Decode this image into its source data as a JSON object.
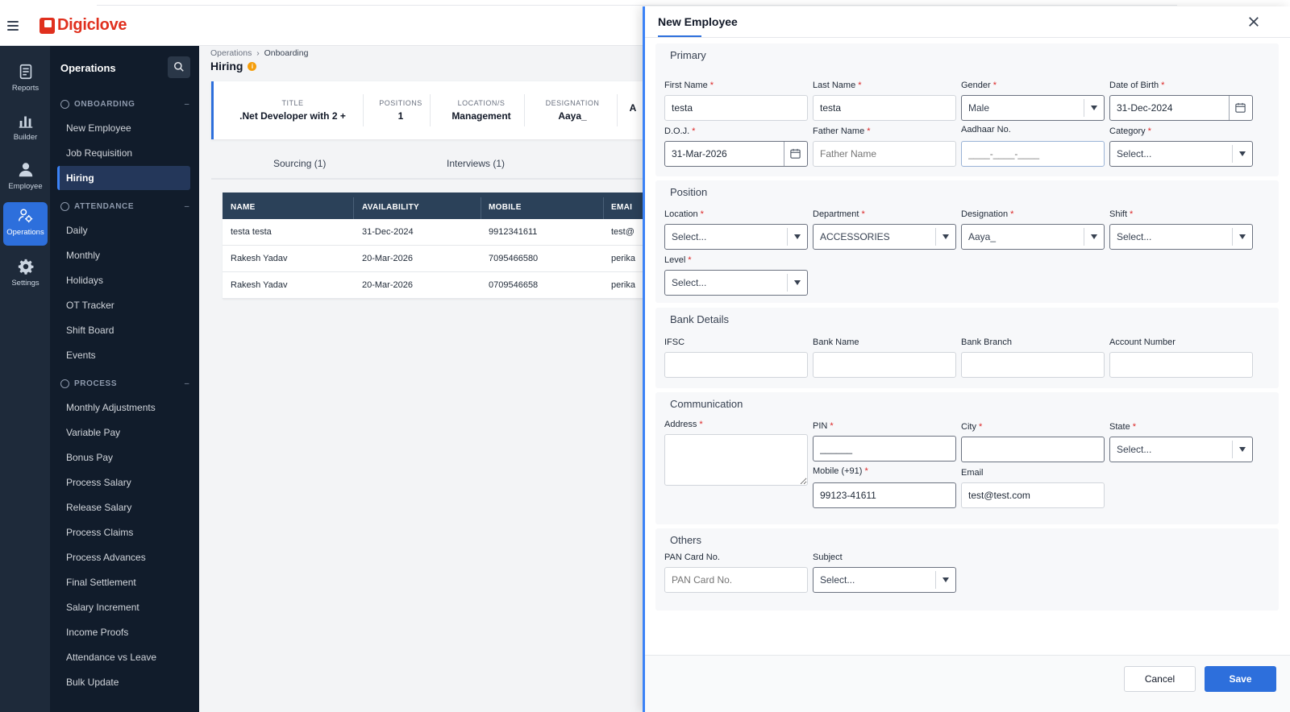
{
  "app": {
    "brand": "Digiclove"
  },
  "rail": [
    {
      "label": "Reports",
      "icon": "reports-icon"
    },
    {
      "label": "Builder",
      "icon": "builder-icon"
    },
    {
      "label": "Employee",
      "icon": "employee-icon"
    },
    {
      "label": "Operations",
      "icon": "operations-icon",
      "active": true
    },
    {
      "label": "Settings",
      "icon": "settings-icon"
    }
  ],
  "nav": {
    "title": "Operations",
    "sections": [
      {
        "label": "ONBOARDING",
        "items": [
          "New Employee",
          "Job Requisition",
          "Hiring"
        ]
      },
      {
        "label": "ATTENDANCE",
        "items": [
          "Daily",
          "Monthly",
          "Holidays",
          "OT Tracker",
          "Shift Board",
          "Events"
        ]
      },
      {
        "label": "PROCESS",
        "items": [
          "Monthly Adjustments",
          "Variable Pay",
          "Bonus Pay",
          "Process Salary",
          "Release Salary",
          "Process Claims",
          "Process Advances",
          "Final Settlement",
          "Salary Increment",
          "Income Proofs",
          "Attendance vs Leave",
          "Bulk Update"
        ]
      }
    ],
    "active_item": "Hiring"
  },
  "main": {
    "breadcrumb": {
      "parent": "Operations",
      "current": "Onboarding"
    },
    "title": "Hiring",
    "summary": [
      {
        "key": "TITLE",
        "value": ".Net Developer with 2 +"
      },
      {
        "key": "POSITIONS",
        "value": "1"
      },
      {
        "key": "LOCATION/S",
        "value": "Management"
      },
      {
        "key": "DESIGNATION",
        "value": "Aaya_"
      },
      {
        "key": "",
        "value": "A"
      }
    ],
    "tabs": [
      "Sourcing (1)",
      "Interviews (1)"
    ],
    "grid": {
      "columns": [
        "NAME",
        "AVAILABILITY",
        "MOBILE",
        "EMAI"
      ],
      "rows": [
        [
          "testa testa",
          "31-Dec-2024",
          "9912341611",
          "test@"
        ],
        [
          "Rakesh Yadav",
          "20-Mar-2026",
          "7095466580",
          "perika"
        ],
        [
          "Rakesh Yadav",
          "20-Mar-2026",
          "0709546658",
          "perika"
        ]
      ]
    }
  },
  "drawer": {
    "title": "New Employee",
    "sections": {
      "primary": "Primary",
      "position": "Position",
      "bank": "Bank Details",
      "communication": "Communication",
      "others": "Others"
    },
    "fields": {
      "first_name": {
        "label": "First Name",
        "value": "testa"
      },
      "last_name": {
        "label": "Last Name",
        "value": "testa"
      },
      "gender": {
        "label": "Gender",
        "value": "Male"
      },
      "dob": {
        "label": "Date of Birth",
        "value": "31-Dec-2024"
      },
      "doj": {
        "label": "D.O.J.",
        "value": "31-Mar-2026"
      },
      "father_name": {
        "label": "Father Name",
        "placeholder": "Father Name"
      },
      "aadhaar": {
        "label": "Aadhaar No.",
        "placeholder": "____-____-____"
      },
      "category": {
        "label": "Category",
        "value": "Select..."
      },
      "location": {
        "label": "Location",
        "value": "Select..."
      },
      "department": {
        "label": "Department",
        "value": "ACCESSORIES"
      },
      "designation": {
        "label": "Designation",
        "value": "Aaya_"
      },
      "shift": {
        "label": "Shift",
        "value": "Select..."
      },
      "level": {
        "label": "Level",
        "value": "Select..."
      },
      "ifsc": {
        "label": "IFSC",
        "value": ""
      },
      "bank_name": {
        "label": "Bank Name",
        "value": ""
      },
      "bank_branch": {
        "label": "Bank Branch",
        "value": ""
      },
      "account_number": {
        "label": "Account Number",
        "value": ""
      },
      "address": {
        "label": "Address",
        "value": ""
      },
      "pin": {
        "label": "PIN",
        "value": "______"
      },
      "city": {
        "label": "City",
        "value": ""
      },
      "state": {
        "label": "State",
        "value": "Select..."
      },
      "mobile": {
        "label": "Mobile (+91)",
        "value": "99123-41611"
      },
      "email": {
        "label": "Email",
        "value": "test@test.com"
      },
      "pan": {
        "label": "PAN Card No.",
        "placeholder": "PAN Card No."
      },
      "subject": {
        "label": "Subject",
        "value": "Select..."
      }
    },
    "buttons": {
      "cancel": "Cancel",
      "save": "Save"
    }
  }
}
